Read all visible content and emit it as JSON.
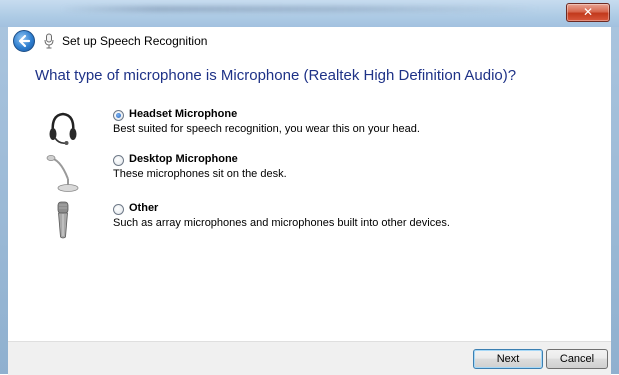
{
  "window": {
    "title": "Set up Speech Recognition",
    "close_label": "✕"
  },
  "heading": "What type of microphone is Microphone (Realtek High Definition Audio)?",
  "options": [
    {
      "label": "Headset Microphone",
      "description": "Best suited for speech recognition, you wear this on your head.",
      "selected": true,
      "icon": "headset-icon"
    },
    {
      "label": "Desktop Microphone",
      "description": "These microphones sit on the desk.",
      "selected": false,
      "icon": "desktop-microphone-icon"
    },
    {
      "label": "Other",
      "description": "Such as array microphones and microphones built into other devices.",
      "selected": false,
      "icon": "handheld-microphone-icon"
    }
  ],
  "footer": {
    "next_label": "Next",
    "cancel_label": "Cancel"
  }
}
